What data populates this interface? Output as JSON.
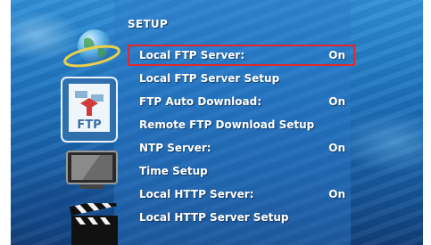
{
  "header": {
    "title": "SETUP"
  },
  "icons": {
    "globe": "globe-icon",
    "ftp": "ftp-icon",
    "tv": "tv-icon",
    "clapperboard": "clapperboard-icon",
    "ftp_icon_text": "FTP"
  },
  "menu": {
    "items": [
      {
        "label": "Local FTP Server:",
        "value": "On"
      },
      {
        "label": "Local FTP Server Setup",
        "value": ""
      },
      {
        "label": "FTP Auto Download:",
        "value": "On"
      },
      {
        "label": "Remote FTP Download Setup",
        "value": ""
      },
      {
        "label": "NTP Server:",
        "value": "On"
      },
      {
        "label": "Time Setup",
        "value": ""
      },
      {
        "label": "Local HTTP Server:",
        "value": "On"
      },
      {
        "label": "Local HTTP Server Setup",
        "value": ""
      }
    ],
    "selected_index": 0
  },
  "colors": {
    "highlight_border": "#e0282d",
    "text": "#ffffff",
    "background": "#1e72bd"
  }
}
